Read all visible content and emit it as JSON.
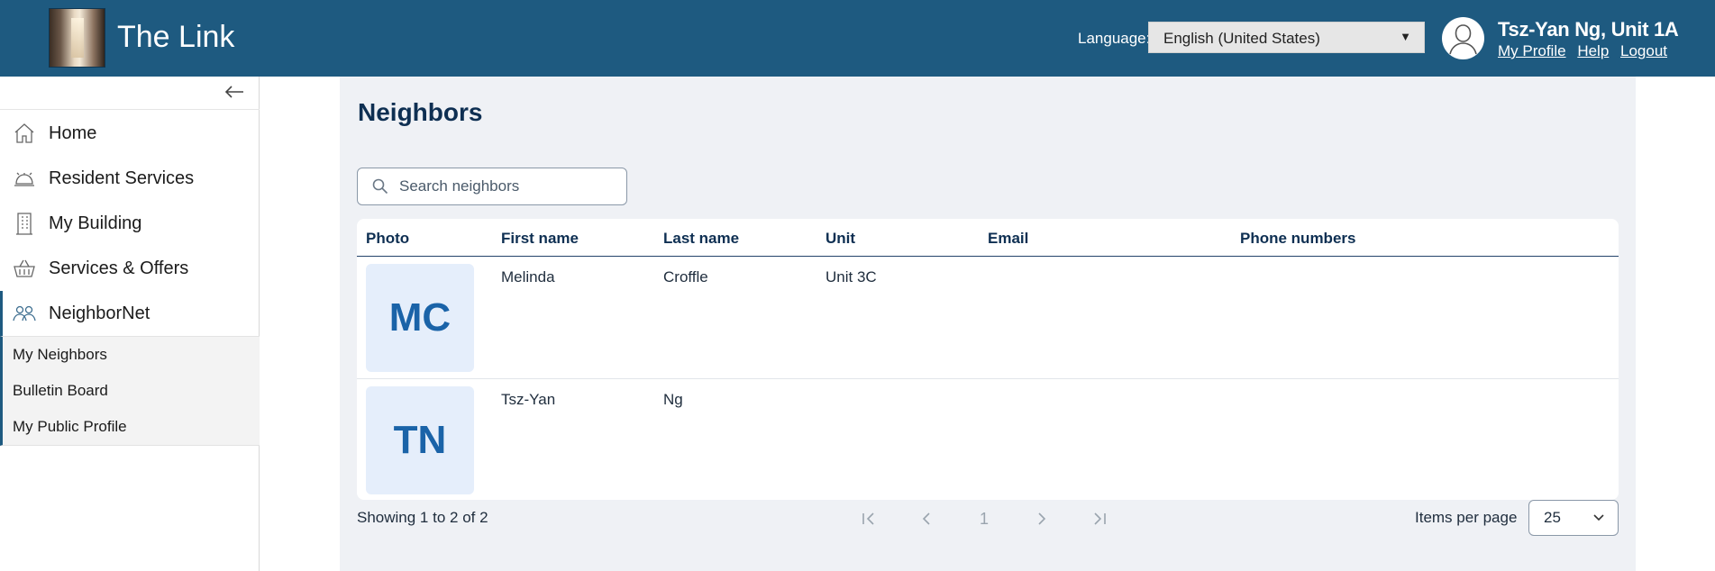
{
  "header": {
    "brand": "The Link",
    "language_label": "Language:",
    "language_value": "English (United States)",
    "user_name": "Tsz-Yan Ng, Unit 1A",
    "links": [
      "My Profile",
      "Help",
      "Logout"
    ]
  },
  "sidebar": {
    "items": [
      {
        "label": "Home",
        "icon": "home-icon"
      },
      {
        "label": "Resident Services",
        "icon": "bell-icon"
      },
      {
        "label": "My Building",
        "icon": "building-icon"
      },
      {
        "label": "Services & Offers",
        "icon": "basket-icon"
      },
      {
        "label": "NeighborNet",
        "icon": "people-icon"
      }
    ],
    "subitems": [
      "My Neighbors",
      "Bulletin Board",
      "My Public Profile"
    ]
  },
  "main": {
    "title": "Neighbors",
    "search_placeholder": "Search neighbors",
    "columns": [
      "Photo",
      "First name",
      "Last name",
      "Unit",
      "Email",
      "Phone numbers"
    ],
    "rows": [
      {
        "initials": "MC",
        "first": "Melinda",
        "last": "Croffle",
        "unit": "Unit 3C",
        "email": "",
        "phone": ""
      },
      {
        "initials": "TN",
        "first": "Tsz-Yan",
        "last": "Ng",
        "unit": "",
        "email": "",
        "phone": ""
      }
    ],
    "showing": "Showing 1 to 2 of 2",
    "page": "1",
    "items_per_page_label": "Items per page",
    "items_per_page": "25"
  },
  "colors": {
    "header_bg": "#1e5a80",
    "main_bg": "#eff1f5",
    "title": "#0e2f52",
    "initials": "#1a63a8",
    "photo_bg": "#e5eefb"
  }
}
